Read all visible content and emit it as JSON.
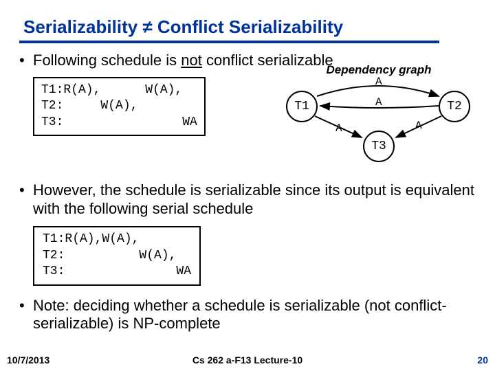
{
  "title": "Serializability ≠ Conflict Serializability",
  "bullet1_pre": "Following schedule is ",
  "bullet1_word": "not",
  "bullet1_post": " conflict serializable",
  "dep_caption": "Dependency graph",
  "nodes": {
    "t1": "T1",
    "t2": "T2",
    "t3": "T3"
  },
  "edge_label": "A",
  "schedule1": {
    "l1": "T1:R(A),      W(A),",
    "l2": "T2:     W(A),",
    "l3": "T3:                WA"
  },
  "bullet2": "However, the schedule is serializable since its output is equivalent with the following serial schedule",
  "schedule2": {
    "l1": "T1:R(A),W(A),",
    "l2": "T2:          W(A),",
    "l3": "T3:               WA"
  },
  "bullet3": "Note: deciding whether a schedule is serializable (not conflict-serializable) is NP-complete",
  "footer": {
    "date": "10/7/2013",
    "center": "Cs 262 a-F13 Lecture-10",
    "page": "20"
  }
}
